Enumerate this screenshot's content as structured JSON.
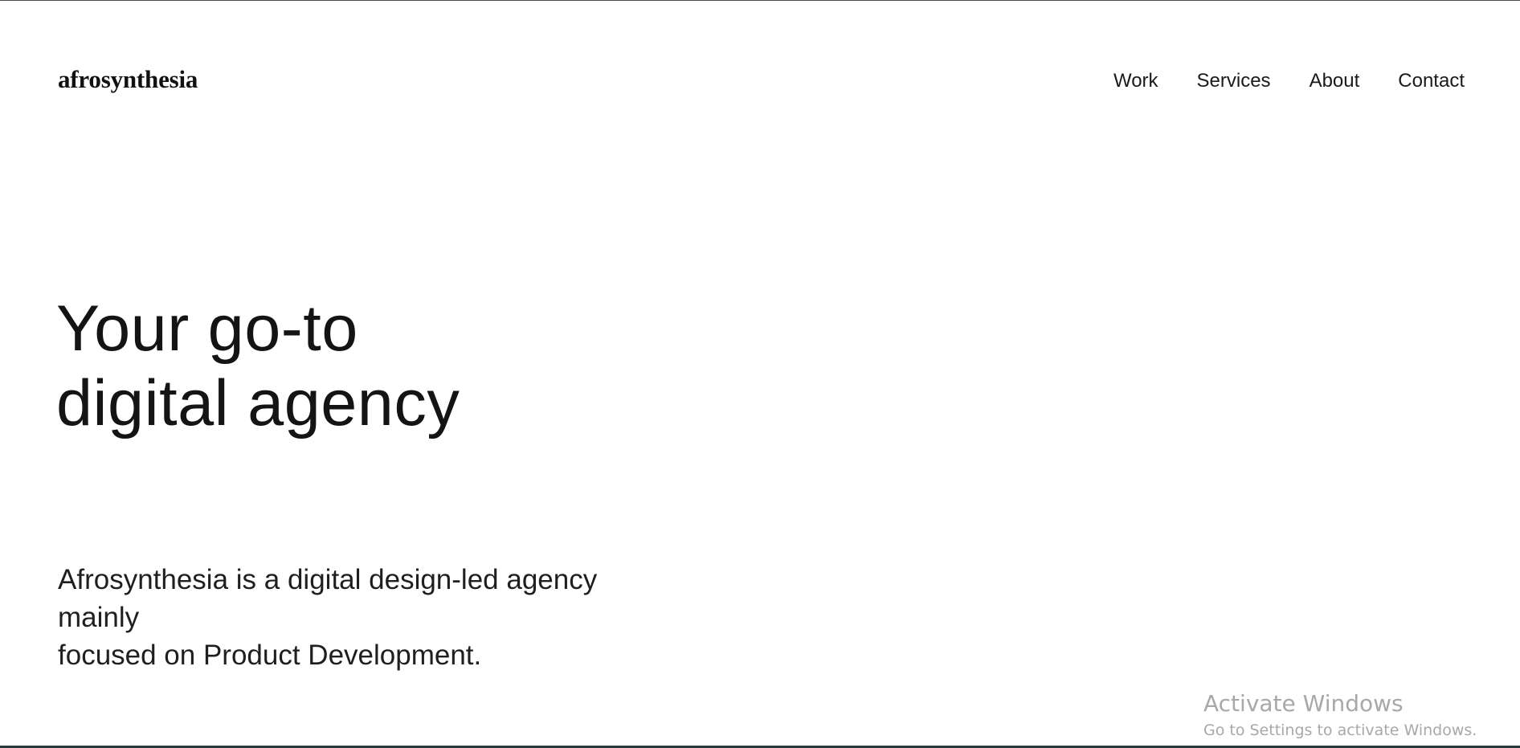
{
  "header": {
    "brand": "afrosynthesia",
    "nav": [
      {
        "label": "Work"
      },
      {
        "label": "Services"
      },
      {
        "label": "About"
      },
      {
        "label": "Contact"
      }
    ]
  },
  "hero": {
    "line1": "Your go-to",
    "line2": "digital agency"
  },
  "intro": {
    "line1": "Afrosynthesia is a digital design-led agency",
    "line2": "mainly",
    "line3": "focused on Product Development."
  },
  "watermark": {
    "title": "Activate Windows",
    "subtitle": "Go to Settings to activate Windows."
  }
}
